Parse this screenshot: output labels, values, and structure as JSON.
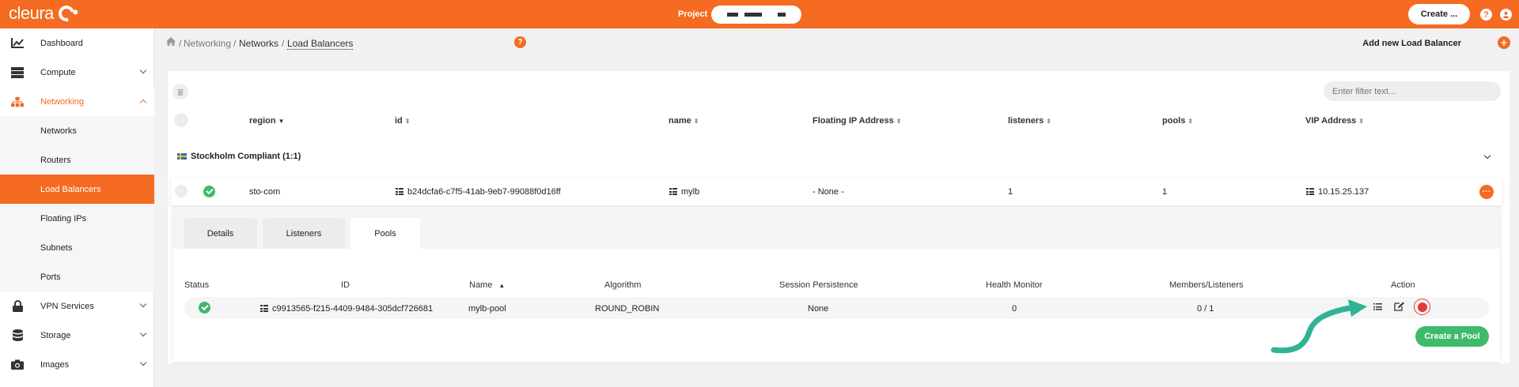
{
  "topbar": {
    "logo_text": "cleura",
    "project_label": "Project",
    "create_label": "Create ...",
    "help_glyph": "?",
    "brand_color": "#f46b21"
  },
  "sidebar": {
    "items": [
      {
        "label": "Dashboard",
        "icon": "chart-icon"
      },
      {
        "label": "Compute",
        "icon": "server-icon"
      },
      {
        "label": "Networking",
        "icon": "network-icon"
      },
      {
        "label": "Networks"
      },
      {
        "label": "Routers"
      },
      {
        "label": "Load Balancers"
      },
      {
        "label": "Floating IPs"
      },
      {
        "label": "Subnets"
      },
      {
        "label": "Ports"
      },
      {
        "label": "VPN Services",
        "icon": "lock-icon"
      },
      {
        "label": "Storage",
        "icon": "database-icon"
      },
      {
        "label": "Images",
        "icon": "camera-icon"
      }
    ]
  },
  "breadcrumb": {
    "items": [
      "Networking",
      "Networks",
      "Load Balancers"
    ],
    "separator": "/",
    "help_glyph": "?",
    "add_label": "Add new Load Balancer",
    "add_glyph": "+"
  },
  "filter": {
    "placeholder": "Enter filter text..."
  },
  "table": {
    "headers": [
      "region",
      "id",
      "name",
      "Floating IP Address",
      "listeners",
      "pools",
      "VIP Address"
    ],
    "sort_desc": "▼",
    "sort_both": "⬍",
    "region_group": "Stockholm Compliant (1:1)",
    "row": {
      "region": "sto-com",
      "id": "b24dcfa6-c7f5-41ab-9eb7-99088f0d16ff",
      "name": "mylb",
      "floating_ip": "- None -",
      "listeners": "1",
      "pools": "1",
      "vip": "10.15.25.137",
      "more_glyph": "···"
    }
  },
  "details": {
    "tabs": [
      "Details",
      "Listeners",
      "Pools"
    ],
    "active_tab": "Pools",
    "pool_headers": [
      "Status",
      "ID",
      "Name",
      "Algorithm",
      "Session Persistence",
      "Health Monitor",
      "Members/Listeners",
      "Action"
    ],
    "sort_asc": "▲",
    "pool_row": {
      "id": "c9913565-f215-4409-9484-305dcf726681",
      "name": "mylb-pool",
      "algorithm": "ROUND_ROBIN",
      "session_persistence": "None",
      "health_monitor": "0",
      "members_listeners": "0 / 1"
    },
    "create_pool_label": "Create a Pool"
  },
  "colors": {
    "accent": "#f46b21",
    "success": "#3dbb6a",
    "danger": "#e33a3a",
    "arrow": "#2fb394"
  }
}
